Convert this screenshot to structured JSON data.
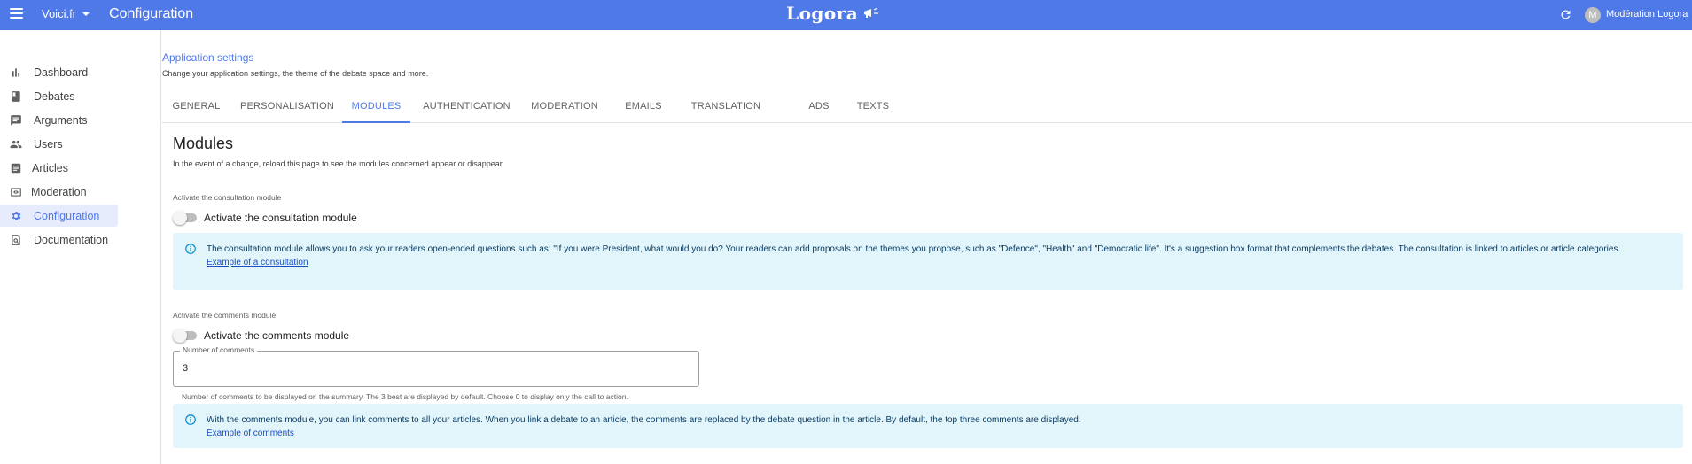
{
  "header": {
    "app_name": "Voici.fr",
    "title": "Configuration",
    "logo": "Logora",
    "user_initial": "M",
    "user_name": "Modération Logora",
    "accent_color": "#5079e8"
  },
  "sidebar": {
    "items": [
      {
        "label": "Dashboard",
        "icon": "bar-chart-icon"
      },
      {
        "label": "Debates",
        "icon": "book-icon"
      },
      {
        "label": "Arguments",
        "icon": "chat-icon"
      },
      {
        "label": "Users",
        "icon": "people-icon"
      },
      {
        "label": "Articles",
        "icon": "article-icon"
      },
      {
        "label": "Moderation",
        "icon": "eye-icon"
      },
      {
        "label": "Configuration",
        "icon": "gear-icon",
        "active": true
      },
      {
        "label": "Documentation",
        "icon": "doc-search-icon"
      }
    ]
  },
  "settings": {
    "title": "Application settings",
    "subtitle": "Change your application settings, the theme of the debate space and more."
  },
  "tabs": [
    "GENERAL",
    "PERSONALISATION",
    "MODULES",
    "AUTHENTICATION",
    "MODERATION",
    "EMAILS",
    "TRANSLATION",
    "ADS",
    "TEXTS"
  ],
  "active_tab": "MODULES",
  "modules": {
    "title": "Modules",
    "description": "In the event of a change, reload this page to see the modules concerned appear or disappear.",
    "consultation": {
      "section_label": "Activate the consultation module",
      "switch_label": "Activate the consultation module",
      "enabled": false,
      "info": "The consultation module allows you to ask your readers open-ended questions such as: \"If you were President, what would you do? Your readers can add proposals on the themes you propose, such as \"Defence\", \"Health\" and \"Democratic life\". It's a suggestion box format that complements the debates. The consultation is linked to articles or article categories.",
      "link": "Example of a consultation"
    },
    "comments": {
      "section_label": "Activate the comments module",
      "switch_label": "Activate the comments module",
      "enabled": false,
      "count_label": "Number of comments",
      "count_value": "3",
      "helper": "Number of comments to be displayed on the summary. The 3 best are displayed by default. Choose 0 to display only the call to action.",
      "info": "With the comments module, you can link comments to all your articles. When you link a debate to an article, the comments are replaced by the debate question in the article. By default, the top three comments are displayed.",
      "link": "Example of comments"
    }
  }
}
